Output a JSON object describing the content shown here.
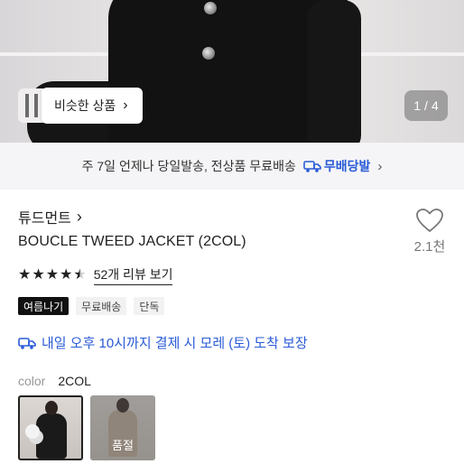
{
  "hero": {
    "similar_button_label": "비슷한 상품",
    "page_current": "1",
    "page_separator": "/",
    "page_total": "4"
  },
  "delivery": {
    "text": "주 7일 언제나 당일발송, 전상품 무료배송",
    "badge_label": "무배당발"
  },
  "product": {
    "brand": "튜드먼트",
    "title": "BOUCLE TWEED JACKET (2COL)",
    "like_count": "2.1천",
    "rating_value": 4.5,
    "reviews_label": "52개 리뷰 보기"
  },
  "tags": [
    "여름나기",
    "무료배송",
    "단독"
  ],
  "guarantee_text": "내일 오후 10시까지 결제 시 모레 (토) 도착 보장",
  "color": {
    "label": "color",
    "value": "2COL",
    "sold_out_label": "품절"
  },
  "colors": {
    "accent_blue": "#2a5bd7",
    "tag_dark": "#111111"
  }
}
